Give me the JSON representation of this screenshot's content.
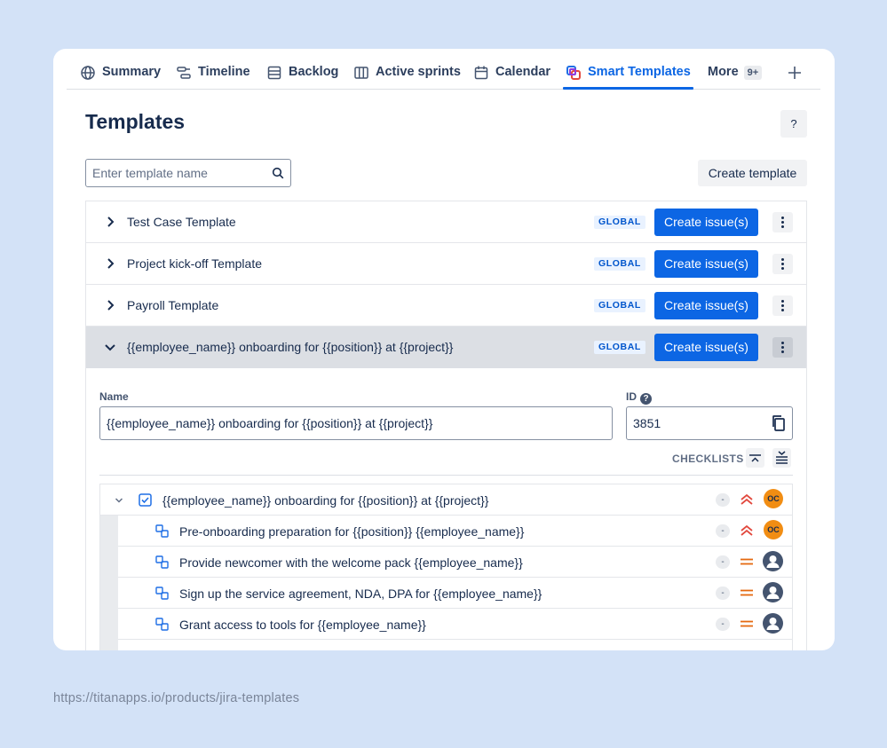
{
  "tabs": [
    {
      "label": "Summary",
      "icon": "globe-icon"
    },
    {
      "label": "Timeline",
      "icon": "timeline-icon"
    },
    {
      "label": "Backlog",
      "icon": "backlog-icon"
    },
    {
      "label": "Active sprints",
      "icon": "board-icon"
    },
    {
      "label": "Calendar",
      "icon": "calendar-icon"
    },
    {
      "label": "Smart Templates",
      "icon": "smart-templates-icon",
      "active": true
    },
    {
      "label": "More",
      "icon": "",
      "badge": "9+"
    }
  ],
  "page_title": "Templates",
  "help_label": "?",
  "search": {
    "placeholder": "Enter template name",
    "value": ""
  },
  "create_template_label": "Create template",
  "templates": [
    {
      "name": "Test Case Template",
      "scope": "GLOBAL",
      "action": "Create issue(s)",
      "expanded": false
    },
    {
      "name": "Project kick-off Template",
      "scope": "GLOBAL",
      "action": "Create issue(s)",
      "expanded": false
    },
    {
      "name": "Payroll Template",
      "scope": "GLOBAL",
      "action": "Create issue(s)",
      "expanded": false
    },
    {
      "name": "{{employee_name}} onboarding for {{position}} at {{project}}",
      "scope": "GLOBAL",
      "action": "Create issue(s)",
      "expanded": true
    }
  ],
  "details": {
    "name_label": "Name",
    "name_value": "{{employee_name}} onboarding for {{position}} at {{project}}",
    "id_label": "ID",
    "id_value": "3851",
    "checklists_label": "CHECKLISTS"
  },
  "checklist_items": [
    {
      "text": "{{employee_name}} onboarding for {{position}} at {{project}}",
      "type": "task",
      "status": "-",
      "priority": "highest",
      "assignee": "OC"
    },
    {
      "text": "Pre-onboarding preparation for {{position}} {{employee_name}}",
      "type": "subtask",
      "status": "-",
      "priority": "highest",
      "assignee": "OC"
    },
    {
      "text": "Provide newcomer with the welcome pack {{employee_name}}",
      "type": "subtask",
      "status": "-",
      "priority": "medium",
      "assignee": ""
    },
    {
      "text": "Sign up the service agreement, NDA, DPA for {{employee_name}}",
      "type": "subtask",
      "status": "-",
      "priority": "medium",
      "assignee": ""
    },
    {
      "text": "Grant access to tools for {{employee_name}}",
      "type": "subtask",
      "status": "-",
      "priority": "medium",
      "assignee": ""
    }
  ],
  "colors": {
    "accent": "#0c66e4",
    "priority_high": "#e2483d",
    "priority_medium": "#e56910",
    "avatar": "#f18d13",
    "background": "#d3e2f7"
  },
  "footer_url": "https://titanapps.io/products/jira-templates"
}
